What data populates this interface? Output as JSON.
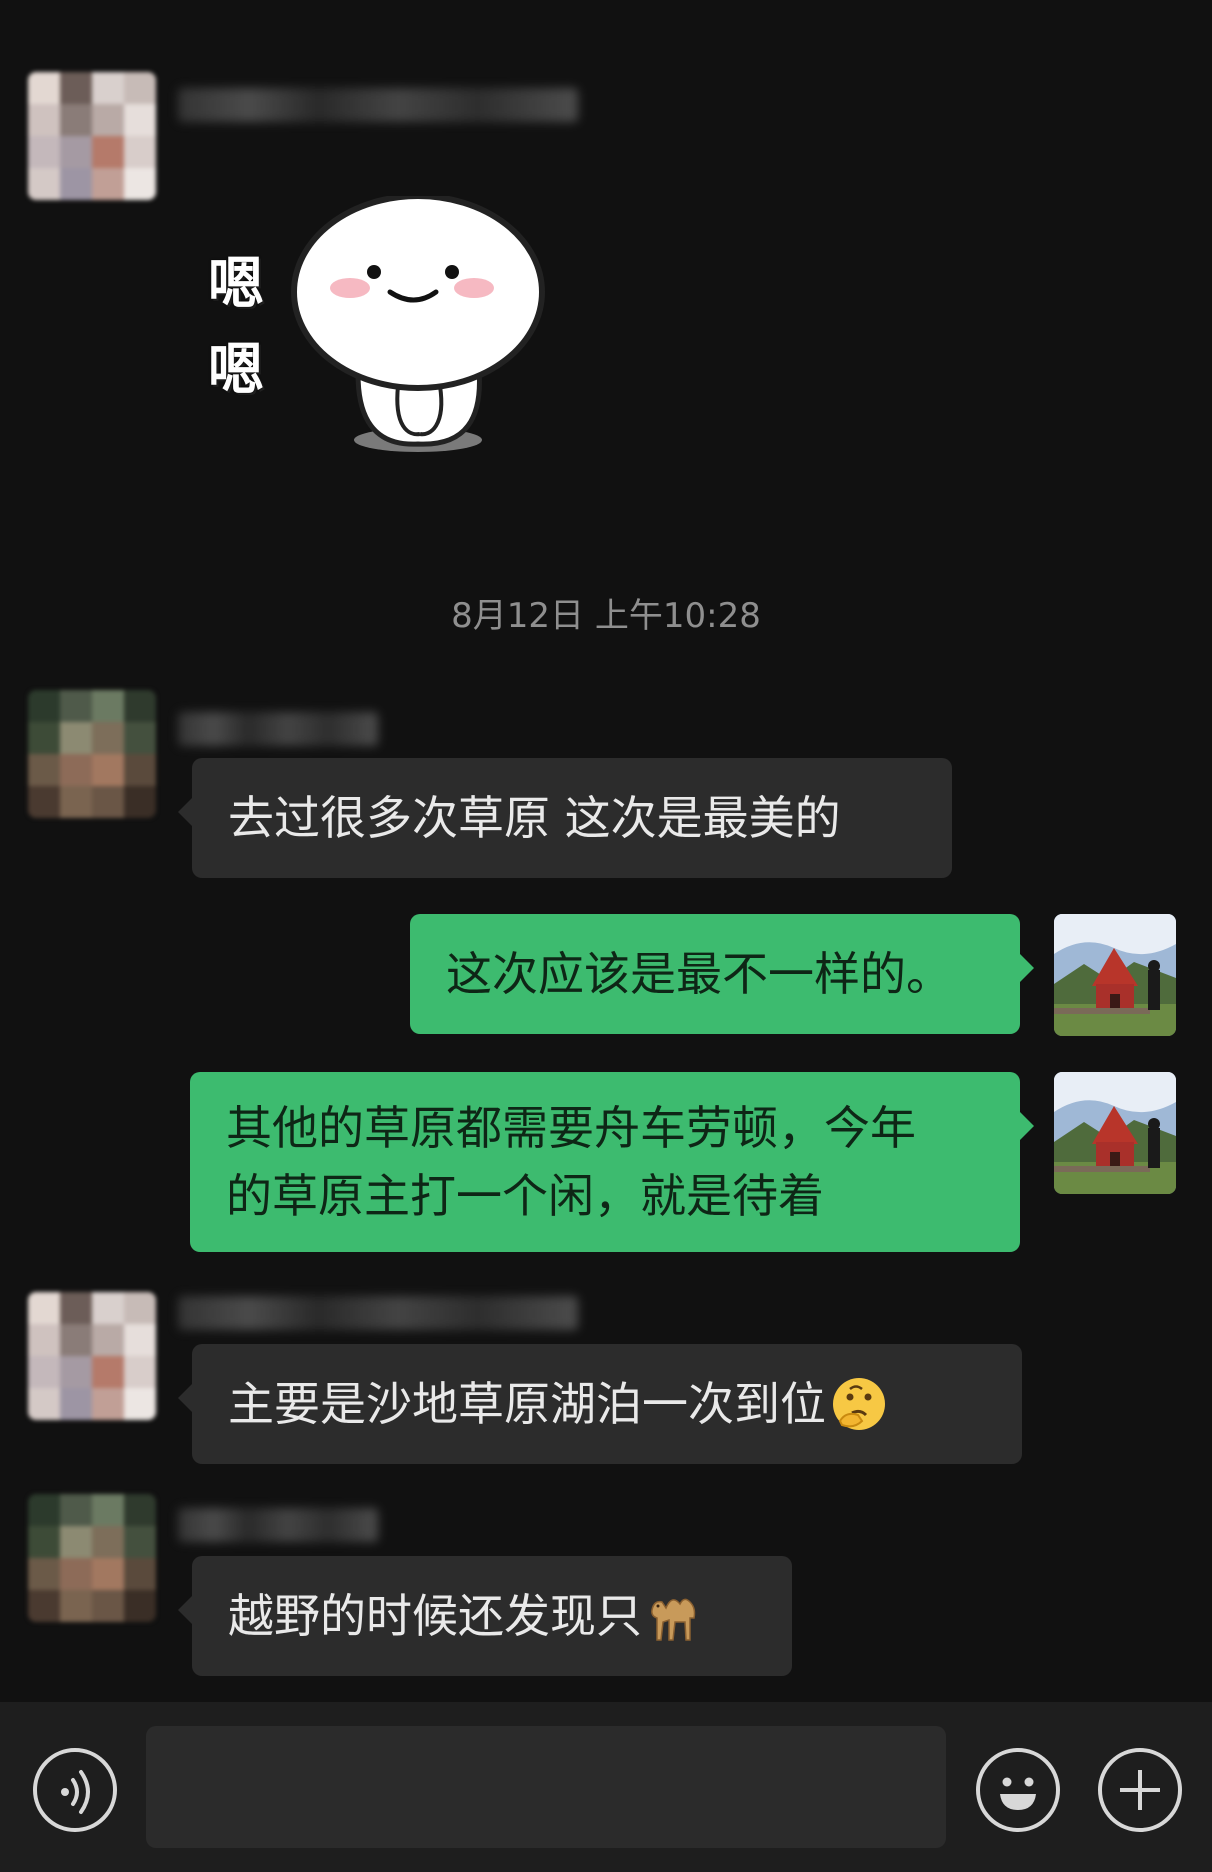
{
  "timestamp": "8月12日 上午10:28",
  "messages": [
    {
      "side": "in",
      "text": "去过很多次草原 这次是最美的"
    },
    {
      "side": "out",
      "text": "这次应该是最不一样的。"
    },
    {
      "side": "out",
      "text": "其他的草原都需要舟车劳顿，今年\n的草原主打一个闲，就是待着"
    },
    {
      "side": "in",
      "text": "主要是沙地草原湖泊一次到位",
      "emoji": "thinking-face-emoji"
    },
    {
      "side": "in",
      "text": "越野的时候还发现只",
      "emoji": "camel-emoji"
    }
  ],
  "sticker": {
    "caption": "嗯\n嗯",
    "icon": "sticker-round-face"
  },
  "input": {
    "value": "",
    "placeholder": ""
  },
  "icons": {
    "voice": "voice-icon",
    "emoji": "emoji-icon",
    "plus": "plus-icon"
  },
  "colors": {
    "background": "#111111",
    "incoming_bubble": "#2c2c2c",
    "outgoing_bubble": "#3dbb6f",
    "timestamp": "#8f8f8f"
  }
}
